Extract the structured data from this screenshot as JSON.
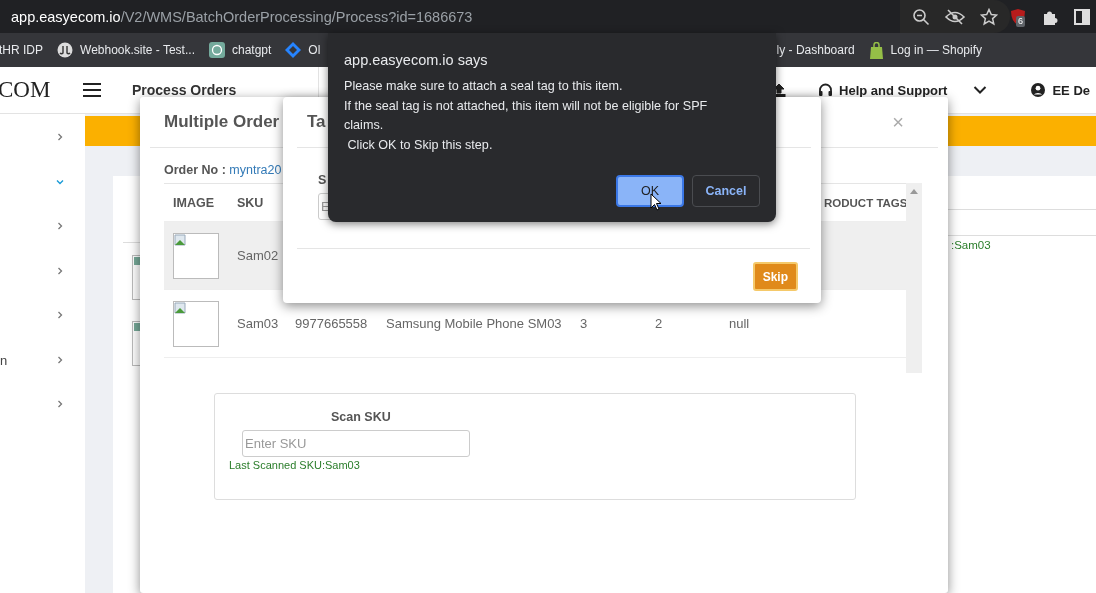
{
  "browser": {
    "url_host": "app.easyecom.io",
    "url_path": "/V2/WMS/BatchOrderProcessing/Process?id=1686673",
    "extension_badge": "6",
    "bookmarks": [
      {
        "label": "tHR IDP",
        "kind": "plain"
      },
      {
        "label": "Webhook.site - Test...",
        "kind": "webhook"
      },
      {
        "label": "chatgpt",
        "kind": "chatgpt"
      },
      {
        "label": "Ol",
        "kind": "diamond"
      }
    ],
    "bookmarks_right": [
      {
        "label": "ly - Dashboard",
        "kind": "plain"
      },
      {
        "label": "Log in — Shopify",
        "kind": "shopify"
      }
    ]
  },
  "header": {
    "logo": "COM",
    "title": "Process Orders",
    "help": "Help and Support",
    "user": "EE De"
  },
  "sidebar": {
    "items": [
      {
        "expanded": false
      },
      {
        "expanded": true
      },
      {
        "expanded": false
      },
      {
        "expanded": false
      },
      {
        "expanded": false
      },
      {
        "label": "n",
        "expanded": false
      },
      {
        "expanded": false
      }
    ]
  },
  "background_page": {
    "last_scanned": ":Sam03"
  },
  "order_modal": {
    "title": "Multiple Order",
    "close": "×",
    "order_label": "Order No :",
    "order_no": "myntra20",
    "columns": [
      "IMAGE",
      "SKU",
      "RODUCT TAGS"
    ],
    "rows": [
      {
        "sku": "Sam02",
        "selected": true
      },
      {
        "sku": "Sam03",
        "selected": false,
        "cells": [
          "9977665558",
          "Samsung Mobile Phone SM03",
          "3",
          "2",
          "null"
        ]
      }
    ],
    "scan": {
      "label": "Scan SKU",
      "placeholder": "Enter SKU",
      "last_scanned": "Last Scanned SKU:Sam03"
    }
  },
  "tag_modal": {
    "title": "Ta",
    "field_label": "S",
    "placeholder": "E",
    "skip": "Skip"
  },
  "alert": {
    "title": "app.easyecom.io says",
    "message": [
      "Please make sure to attach a seal tag to this item.",
      "If the seal tag is not attached, this item will not be eligible for SPF claims.",
      " Click OK to Skip this step."
    ],
    "buttons": [
      {
        "label": "OK",
        "selected": true
      },
      {
        "label": "Cancel",
        "selected": false
      }
    ]
  }
}
